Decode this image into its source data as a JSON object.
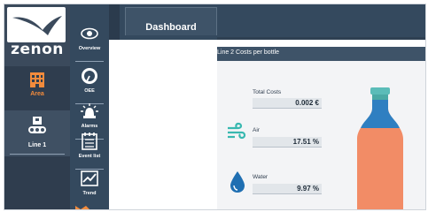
{
  "app": {
    "logo_text": "zenon"
  },
  "left_nav": {
    "items": [
      {
        "label": "Area",
        "icon": "factory-icon",
        "active": true,
        "color": "#f28b3c"
      },
      {
        "label": "Line 1",
        "icon": "line-icon",
        "active": false
      }
    ]
  },
  "icon_nav": {
    "items": [
      {
        "label": "Overview",
        "icon": "eye-icon"
      },
      {
        "label": "OEE",
        "icon": "gauge-icon"
      },
      {
        "label": "Alarms",
        "icon": "alarm-bell-icon"
      },
      {
        "label": "Event list",
        "icon": "event-list-icon"
      },
      {
        "label": "Trend",
        "icon": "trend-chart-icon"
      }
    ]
  },
  "header": {
    "tab_label": "Dashboard"
  },
  "panel": {
    "title": "Line 2 Costs per bottle",
    "total_costs": {
      "label": "Total Costs",
      "value": "0.002 €"
    },
    "air": {
      "label": "Air",
      "value": "17.51 %"
    },
    "water": {
      "label": "Water",
      "value": "9.97 %"
    }
  },
  "colors": {
    "accent_orange": "#f28b3c",
    "bottle_body": "#f28c66",
    "bottle_neck": "#2f7fc1",
    "bottle_cap": "#5bbcb8",
    "air_icon": "#38b8b0",
    "water_icon": "#1f6fb2",
    "nav_bg": "#34495e"
  }
}
